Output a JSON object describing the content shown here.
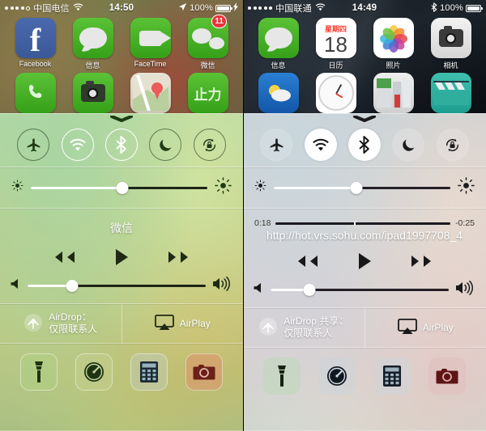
{
  "panels": [
    {
      "id": "left",
      "status": {
        "carrier": "中国电信",
        "time": "14:50",
        "battery": "100%",
        "signal_dots": 4,
        "wifi_icon": "wifi-icon",
        "location_icon": "location-arrow-icon",
        "charging_icon": "bolt-icon"
      },
      "apps": [
        {
          "label": "Facebook",
          "icon": "facebook-icon",
          "badge": ""
        },
        {
          "label": "信息",
          "icon": "messages-icon",
          "badge": ""
        },
        {
          "label": "FaceTime",
          "icon": "facetime-icon",
          "badge": ""
        },
        {
          "label": "微信",
          "icon": "wechat-icon",
          "badge": "11"
        }
      ],
      "apps_row2": [
        {
          "label": "",
          "icon": "phone-icon"
        },
        {
          "label": "",
          "icon": "camera-icon"
        },
        {
          "label": "",
          "icon": "maps-icon"
        },
        {
          "label": "",
          "icon": "app-icon"
        }
      ],
      "toggles": [
        {
          "name": "airplane-mode-toggle",
          "icon": "airplane-icon",
          "state": "off"
        },
        {
          "name": "wifi-toggle",
          "icon": "wifi-icon",
          "state": "on"
        },
        {
          "name": "bluetooth-toggle",
          "icon": "bluetooth-icon",
          "state": "on"
        },
        {
          "name": "do-not-disturb-toggle",
          "icon": "moon-icon",
          "state": "off"
        },
        {
          "name": "rotation-lock-toggle",
          "icon": "rotation-lock-icon",
          "state": "off"
        }
      ],
      "brightness": {
        "value": 52,
        "low_icon": "sun-small-icon",
        "high_icon": "sun-large-icon"
      },
      "media": {
        "now_playing": "微信",
        "rewind": "rewind-icon",
        "play": "play-icon",
        "forward": "fast-forward-icon",
        "volume": 25,
        "vol_low_icon": "speaker-mute-icon",
        "vol_high_icon": "speaker-loud-icon"
      },
      "share": {
        "airdrop_line1": "AirDrop：",
        "airdrop_line2": "仅限联系人",
        "airplay": "AirPlay"
      },
      "shortcuts": [
        {
          "name": "flashlight-shortcut",
          "icon": "flashlight-icon",
          "tint": "#9fc470"
        },
        {
          "name": "timer-shortcut",
          "icon": "timer-icon",
          "tint": "#b6bf7d"
        },
        {
          "name": "calculator-shortcut",
          "icon": "calculator-icon",
          "tint": "#b9c5a7"
        },
        {
          "name": "camera-shortcut",
          "icon": "camera-icon",
          "tint": "#d8916c"
        }
      ]
    },
    {
      "id": "right",
      "status": {
        "carrier": "中国联通",
        "time": "14:49",
        "battery": "100%",
        "signal_dots": 5,
        "wifi_icon": "wifi-icon",
        "bluetooth_icon": "bluetooth-icon"
      },
      "apps": [
        {
          "label": "信息",
          "icon": "messages-icon",
          "badge": ""
        },
        {
          "label": "日历",
          "icon": "calendar-icon",
          "badge": "",
          "cal_weekday": "星期四",
          "cal_day": "18"
        },
        {
          "label": "照片",
          "icon": "photos-icon",
          "badge": ""
        },
        {
          "label": "相机",
          "icon": "camera-icon",
          "badge": ""
        }
      ],
      "apps_row2": [
        {
          "label": "",
          "icon": "weather-icon"
        },
        {
          "label": "",
          "icon": "clock-icon"
        },
        {
          "label": "",
          "icon": "newsstand-icon"
        },
        {
          "label": "",
          "icon": "videos-icon"
        }
      ],
      "toggles": [
        {
          "name": "airplane-mode-toggle",
          "icon": "airplane-icon",
          "state": "off"
        },
        {
          "name": "wifi-toggle",
          "icon": "wifi-icon",
          "state": "on"
        },
        {
          "name": "bluetooth-toggle",
          "icon": "bluetooth-icon",
          "state": "on"
        },
        {
          "name": "do-not-disturb-toggle",
          "icon": "moon-icon",
          "state": "off"
        },
        {
          "name": "rotation-lock-toggle",
          "icon": "rotation-lock-icon",
          "state": "off"
        }
      ],
      "brightness": {
        "value": 47,
        "low_icon": "sun-small-icon",
        "high_icon": "sun-large-icon"
      },
      "media": {
        "elapsed": "0:18",
        "remaining": "-0:25",
        "progress": 45,
        "url": "http://hot.vrs.sohu.com/ipad1997708_4",
        "rewind": "rewind-icon",
        "play": "play-icon",
        "forward": "fast-forward-icon",
        "volume": 22,
        "vol_low_icon": "speaker-mute-icon",
        "vol_high_icon": "speaker-loud-icon"
      },
      "share": {
        "airdrop_line1": "AirDrop 共享：",
        "airdrop_line2": "仅限联系人",
        "airplay": "AirPlay"
      },
      "shortcuts": [
        {
          "name": "flashlight-shortcut",
          "icon": "flashlight-icon",
          "tint": "#bdd2b6"
        },
        {
          "name": "timer-shortcut",
          "icon": "timer-icon",
          "tint": "#c9d2d4"
        },
        {
          "name": "calculator-shortcut",
          "icon": "calculator-icon",
          "tint": "#d2d4d8"
        },
        {
          "name": "camera-shortcut",
          "icon": "camera-icon",
          "tint": "#dfc0bf"
        }
      ]
    }
  ],
  "colors": {
    "badge": "#e8333a",
    "accent_white": "#ffffff",
    "calendar_red": "#fb3b30"
  }
}
